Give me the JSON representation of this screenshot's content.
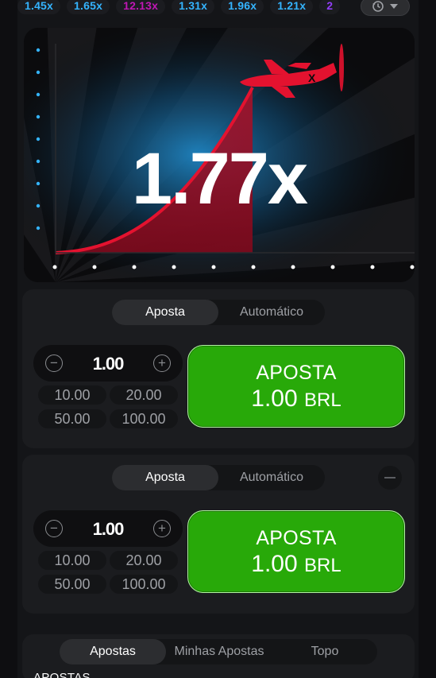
{
  "history": {
    "multipliers": [
      {
        "value": "1.45x",
        "color": "#34b4ff"
      },
      {
        "value": "1.65x",
        "color": "#34b4ff"
      },
      {
        "value": "12.13x",
        "color": "#c017b4"
      },
      {
        "value": "1.31x",
        "color": "#34b4ff"
      },
      {
        "value": "1.96x",
        "color": "#34b4ff"
      },
      {
        "value": "1.21x",
        "color": "#34b4ff"
      },
      {
        "value": "2",
        "color": "#913ef8"
      }
    ],
    "history_icon": "history-clock-icon",
    "toggle_icon": "chevron-down-icon"
  },
  "game": {
    "multiplier": "1.77x",
    "plane_icon": "airplane-icon",
    "curve_color": "#e3122f"
  },
  "panels": [
    {
      "tabs": [
        "Aposta",
        "Automático"
      ],
      "active_tab": "Aposta",
      "amount": "1.00",
      "quick_amounts": [
        "10.00",
        "20.00",
        "50.00",
        "100.00"
      ],
      "bet_label": "APOSTA",
      "bet_amount": "1.00",
      "bet_currency": "BRL"
    },
    {
      "tabs": [
        "Aposta",
        "Automático"
      ],
      "active_tab": "Aposta",
      "amount": "1.00",
      "quick_amounts": [
        "10.00",
        "20.00",
        "50.00",
        "100.00"
      ],
      "bet_label": "APOSTA",
      "bet_amount": "1.00",
      "bet_currency": "BRL"
    }
  ],
  "bets": {
    "tabs": [
      "Apostas",
      "Minhas Apostas",
      "Topo"
    ],
    "active_tab": "Apostas",
    "section_title": "APOSTAS"
  },
  "colors": {
    "accent_green": "#28a909",
    "low_multiplier": "#34b4ff",
    "high_multiplier": "#c017b4"
  }
}
